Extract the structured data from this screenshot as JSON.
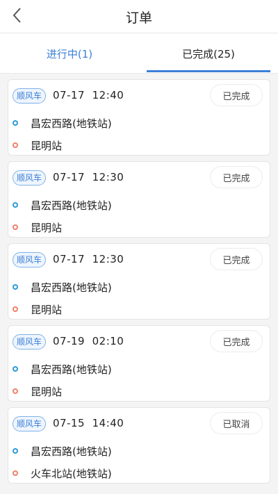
{
  "header": {
    "title": "订单"
  },
  "tabs": [
    {
      "label": "进行中(1)"
    },
    {
      "label": "已完成(25)"
    }
  ],
  "orders": [
    {
      "tag": "顺风车",
      "datetime": "07-17  12:40",
      "status": "已完成",
      "from": "昌宏西路(地铁站)",
      "to": "昆明站"
    },
    {
      "tag": "顺风车",
      "datetime": "07-17  12:30",
      "status": "已完成",
      "from": "昌宏西路(地铁站)",
      "to": "昆明站"
    },
    {
      "tag": "顺风车",
      "datetime": "07-17  12:30",
      "status": "已完成",
      "from": "昌宏西路(地铁站)",
      "to": "昆明站"
    },
    {
      "tag": "顺风车",
      "datetime": "07-19  02:10",
      "status": "已完成",
      "from": "昌宏西路(地铁站)",
      "to": "昆明站"
    },
    {
      "tag": "顺风车",
      "datetime": "07-15  14:40",
      "status": "已取消",
      "from": "昌宏西路(地铁站)",
      "to": "火车北站(地铁站)"
    }
  ],
  "colors": {
    "accent": "#3b7fd8",
    "from_dot": "#2d9ad8",
    "to_dot": "#f0806a"
  },
  "icons": {
    "back": "chevron-left-icon"
  }
}
